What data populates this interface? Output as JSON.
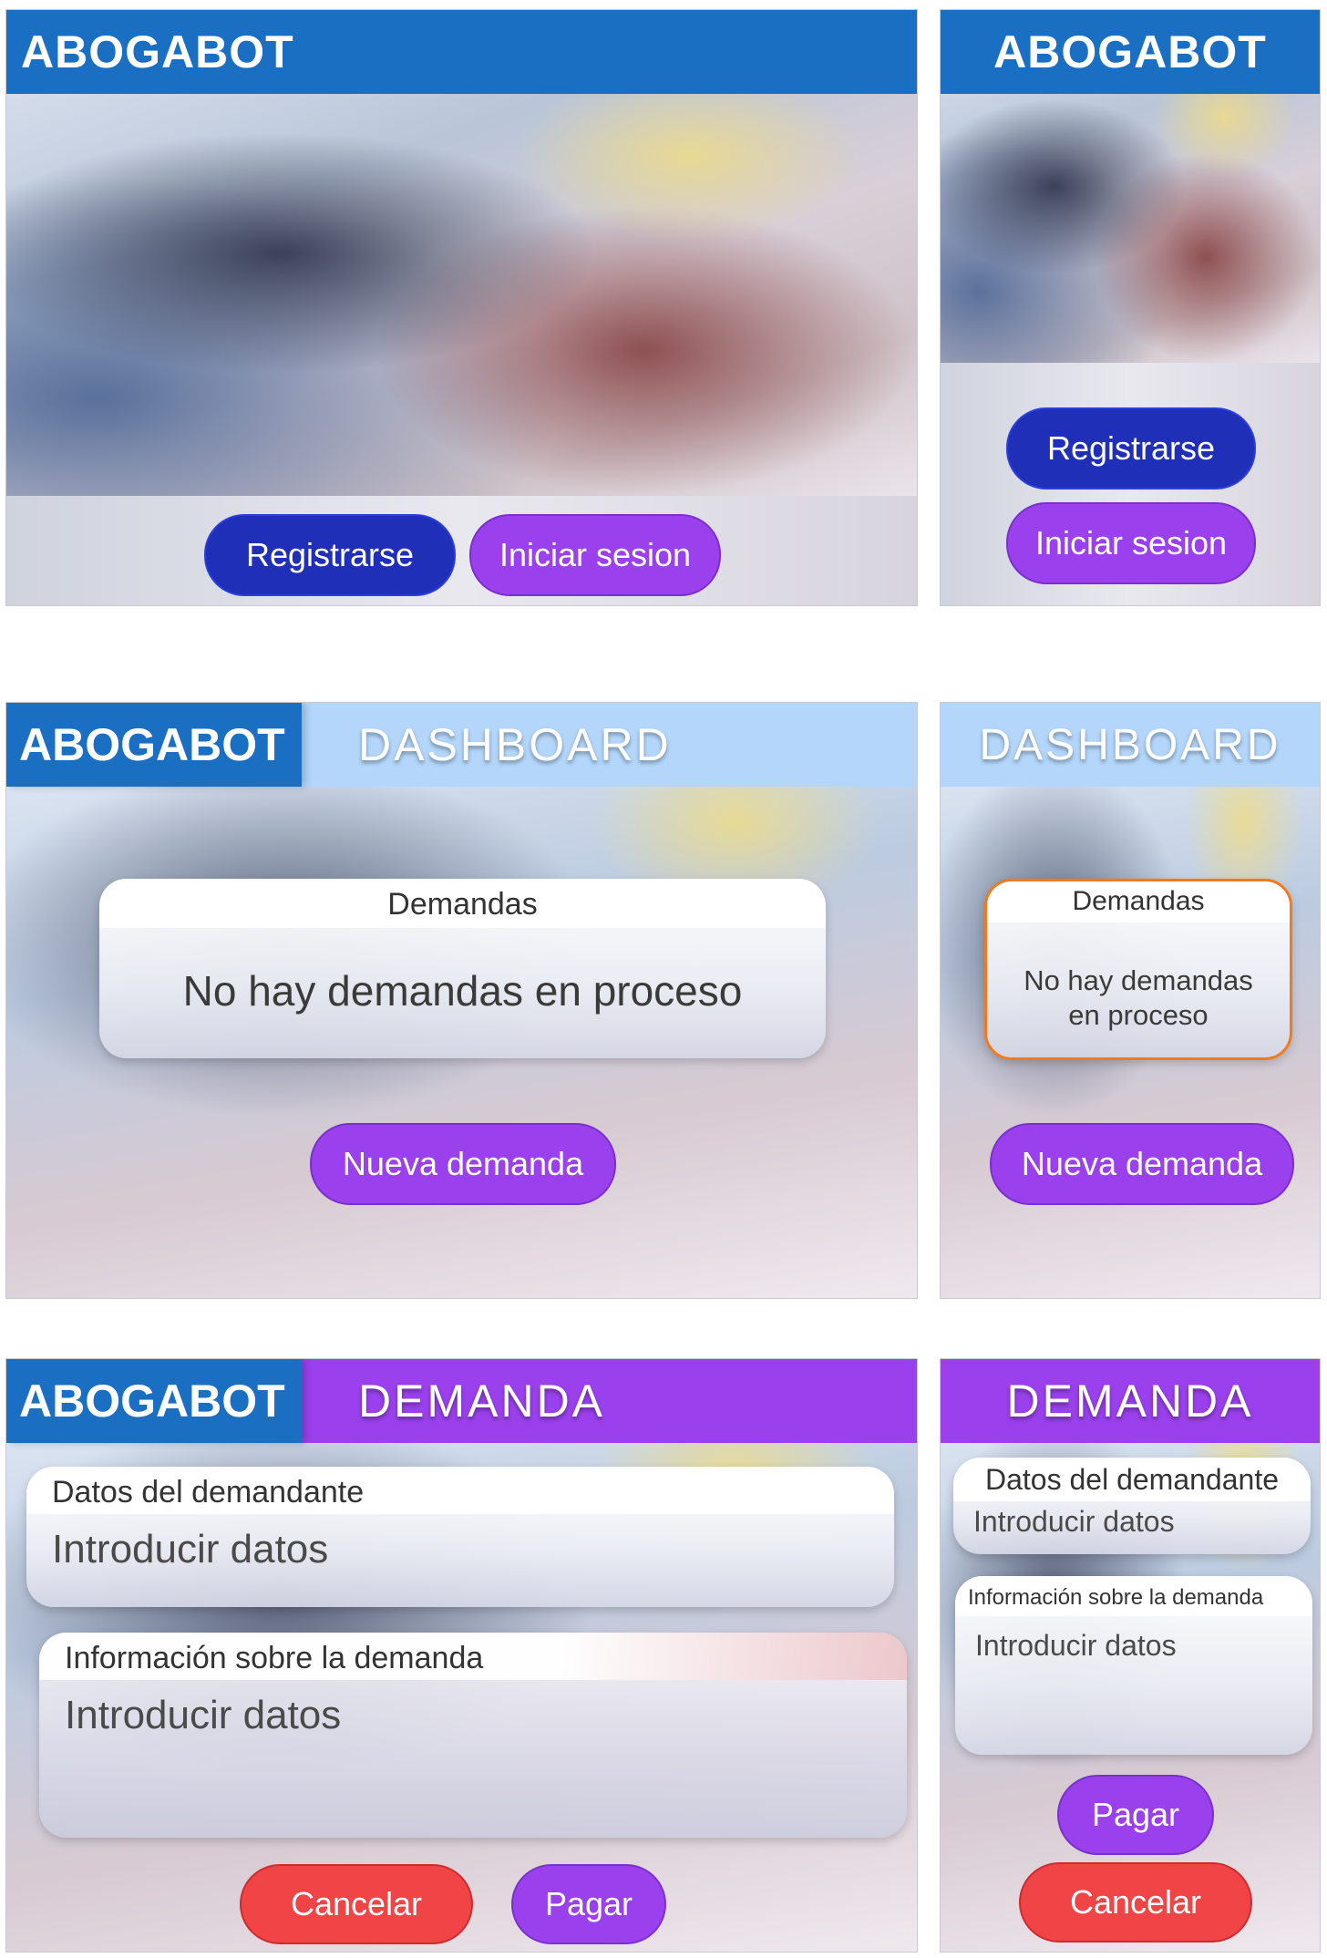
{
  "app_name": "ABOGABOT",
  "landing": {
    "register_label": "Registrarse",
    "login_label": "Iniciar sesion"
  },
  "dashboard": {
    "title": "DASHBOARD",
    "card_title": "Demandas",
    "empty_text": "No hay demandas en proceso",
    "new_label": "Nueva demanda"
  },
  "demanda": {
    "title": "DEMANDA",
    "plaintiff_label": "Datos del demandante",
    "plaintiff_placeholder": "Introducir datos",
    "info_label": "Información sobre la demanda",
    "info_placeholder": "Introducir datos",
    "cancel_label": "Cancelar",
    "pay_label": "Pagar"
  },
  "colors": {
    "brand_blue": "#1b6fc3",
    "dashboard_header": "#b3d6fa",
    "demanda_header": "#9a40ec",
    "register_button": "#1f2fb8",
    "login_button": "#9a40ec",
    "cancel_button": "#f04447",
    "highlight_border": "#f07a1c"
  }
}
